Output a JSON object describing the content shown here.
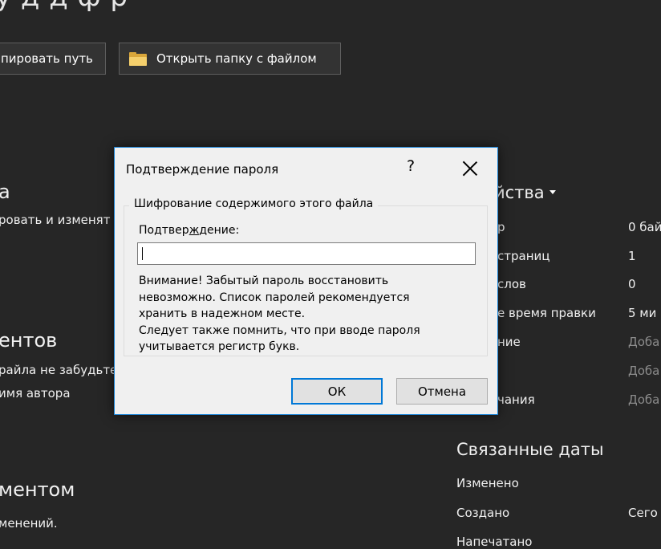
{
  "background": {
    "top_title": "у       д               д                             ф  р",
    "buttons": {
      "copy_path": "пировать путь",
      "open_folder": "Открыть папку с файлом"
    },
    "left": {
      "section1_heading": "а",
      "section1_text": "ровать и изменят",
      "section2_heading": "ентов",
      "section2_line1": "райла не забудьте",
      "section2_line2": "имя автора",
      "section3_heading": "ментом",
      "section3_line1": "менений."
    },
    "properties": {
      "heading": "йства",
      "rows": [
        {
          "label": "р",
          "value": "0 бай"
        },
        {
          "label": "страниц",
          "value": "1"
        },
        {
          "label": "слов",
          "value": "0"
        },
        {
          "label": "е время правки",
          "value": "5 ми"
        },
        {
          "label": "ние",
          "value": "Доба"
        },
        {
          "label": "",
          "value": "Доба"
        },
        {
          "label": "чания",
          "value": "Доба"
        }
      ]
    },
    "related_dates": {
      "heading": "Связанные даты",
      "modified_label": "Изменено",
      "created_label": "Создано",
      "created_value": "Сего",
      "printed_label": "Напечатано"
    }
  },
  "dialog": {
    "title": "Подтверждение пароля",
    "help": "?",
    "group_title": "Шифрование содержимого этого файла",
    "confirm_label_pre": "Подтвер",
    "confirm_label_accel": "ж",
    "confirm_label_post": "дение:",
    "password_value": "",
    "warning": [
      "Внимание! Забытый пароль восстановить",
      "невозможно. Список паролей рекомендуется",
      "хранить в надежном месте.",
      "Следует также помнить, что при вводе пароля",
      "учитывается регистр букв."
    ],
    "ok_label": "ОК",
    "cancel_label": "Отмена"
  }
}
